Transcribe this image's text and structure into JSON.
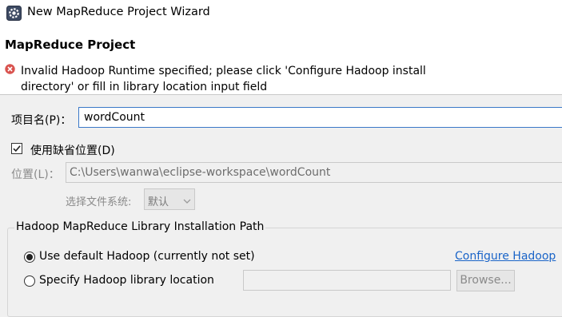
{
  "window": {
    "title": "New MapReduce Project Wizard",
    "icon": "mapreduce-gear-icon"
  },
  "header": {
    "title": "MapReduce Project",
    "error_icon": "error-icon",
    "error_message": "Invalid Hadoop Runtime specified; please click 'Configure Hadoop install directory' or fill in library location input field"
  },
  "form": {
    "project_name_label": "项目名(P)：",
    "project_name_value": "wordCount",
    "use_default_location_label": "使用缺省位置(D)",
    "use_default_location_checked": true,
    "location_label": "位置(L)：",
    "location_value": "C:\\Users\\wanwa\\eclipse-workspace\\wordCount",
    "filesystem_label": "选择文件系统:",
    "filesystem_value": "默认"
  },
  "hadoop_group": {
    "title": "Hadoop MapReduce Library Installation Path",
    "use_default_label": "Use default Hadoop (currently not set)",
    "use_default_selected": true,
    "configure_link": "Configure Hadoop",
    "specify_label": "Specify Hadoop library location",
    "specify_selected": false,
    "library_location_value": "",
    "browse_label": "Browse..."
  },
  "colors": {
    "accent": "#3a78c8",
    "link": "#1a64c8",
    "error": "#d9534f",
    "background": "#f0f0f0"
  }
}
